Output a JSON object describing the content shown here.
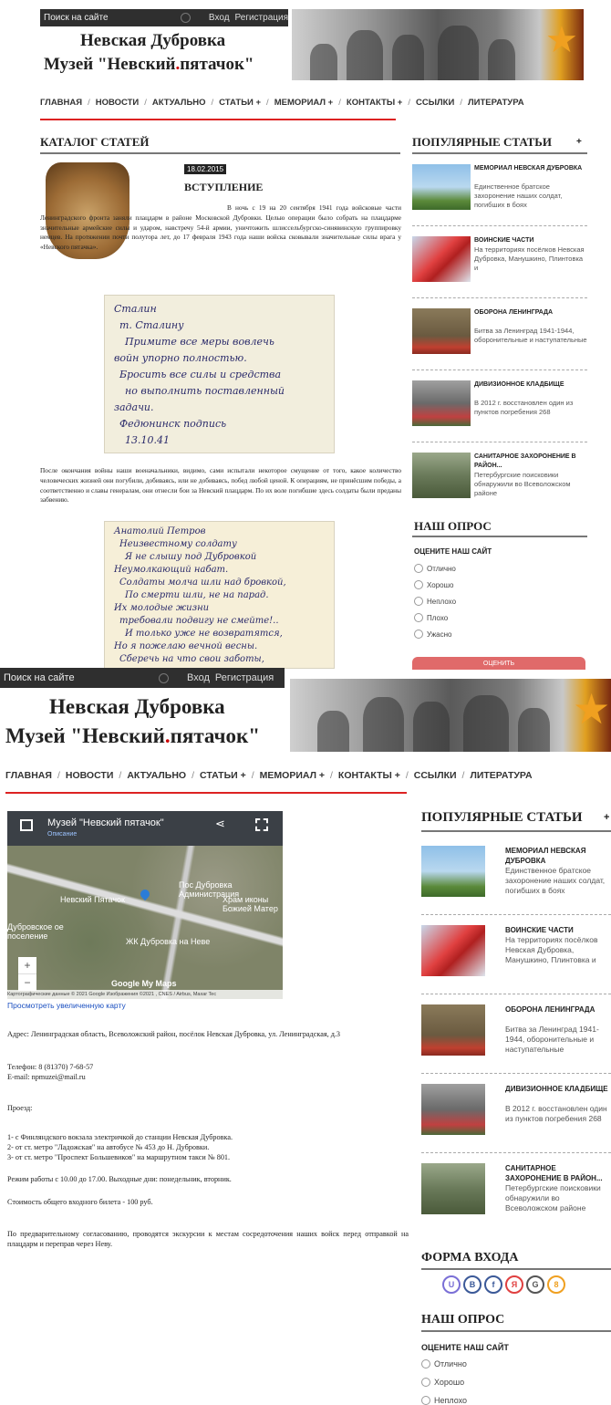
{
  "panel1": {
    "topbar": {
      "search_placeholder": "Поиск на сайте",
      "login": "Вход",
      "register": "Регистрация"
    },
    "site": {
      "title_line1": "Невская Дубровка",
      "title_line2_prefix": "Музей \"Невский",
      "title_dot": ".",
      "title_line2_suffix": "пятачок\""
    },
    "nav": [
      "ГЛАВНАЯ",
      "НОВОСТИ",
      "АКТУАЛЬНО",
      "СТАТЬИ +",
      "МЕМОРИАЛ +",
      "КОНТАКТЫ +",
      "ССЫЛКИ",
      "ЛИТЕРАТУРА"
    ],
    "nav_sep": "/",
    "catalog_heading": "КАТАЛОГ СТАТЕЙ",
    "article": {
      "date": "18.02.2015",
      "title": "ВСТУПЛЕНИЕ",
      "para1": "В ночь с 19 на 20 сентября 1941 года войсковые части Ленинградского фронта заняли плацдарм в районе Московской Дубровки. Целью операции было собрать на плацдарме значительные армейские силы и ударом, навстречу 54-й армии, уничтожить шлиссельбургско-синявинскую группировку немцев. На протяжении почти полутора лет, до 17 февраля 1943 года наши войска сковывали значительные силы врага у «Невского пятачка».",
      "para2": "После окончания войны наши военачальники, видимо, сами испытали некоторое смущение от того, какое количество человеческих жизней они погубили, добиваясь, или не добиваясь, побед любой ценой. К операциям, не принёсшим победы, а соответственно и славы генералам, они отнесли бои за Невский плацдарм. По их воле погибшие здесь солдаты были преданы забвению.",
      "letter1": [
        "Сталин",
        "т. Сталину",
        "Примите все меры вовлечь",
        "войн упорно полностью.",
        "Бросить все силы и средства",
        "но выполнить поставленный",
        "задачи.",
        "Федюнинск      подпись",
        "13.10.41"
      ],
      "letter2": [
        "Анатолий Петров",
        "Неизвестному солдату",
        "Я не слышу под Дубровкой",
        "Неумолкающий набат.",
        "Солдаты молча шли над бровкой,",
        "По смерти шли, не на парад.",
        "Их молодые жизни",
        "требовали подвигу не смейте!..",
        "И только уже не возвратятся,",
        "Но я пожелаю вечной весны.",
        "Сберечь на что свои заботы,"
      ]
    },
    "popular": {
      "heading": "ПОПУЛЯРНЫЕ СТАТЬИ",
      "plus": "+",
      "items": [
        {
          "title": "МЕМОРИАЛ НЕВСКАЯ ДУБРОВКА",
          "desc": "Единственное братское захоронение наших солдат, погибших в боях"
        },
        {
          "title": "ВОИНСКИЕ ЧАСТИ",
          "desc": "На территориях посёлков Невская Дубровка, Манушкино, Плинтовка и"
        },
        {
          "title": "ОБОРОНА ЛЕНИНГРАДА",
          "desc": "Битва за Ленинград 1941-1944, оборонительные и наступательные"
        },
        {
          "title": "ДИВИЗИОННОЕ КЛАДБИЩЕ",
          "desc": "В 2012 г. восстановлен один из пунктов погребения 268"
        },
        {
          "title": "САНИТАРНОЕ ЗАХОРОНЕНИЕ В РАЙОН...",
          "desc": "Петербургские поисковики обнаружили во Всеволожском районе"
        }
      ]
    },
    "poll": {
      "heading": "НАШ ОПРОС",
      "question": "ОЦЕНИТЕ НАШ САЙТ",
      "options": [
        "Отлично",
        "Хорошо",
        "Неплохо",
        "Плохо",
        "Ужасно"
      ],
      "button": "ОЦЕНИТЬ"
    }
  },
  "panel2": {
    "map": {
      "title": "Музей \"Невский пятачок\"",
      "subtitle": "Описание",
      "labels": [
        "Пос Дубровка Администрация",
        "Невский Пятачок",
        "Храм иконы Божией Матер",
        "Дубровское ое поселение",
        "ЖК Дубровка на Неве"
      ],
      "brand": "Google My Maps",
      "attribution": "Картографические данные © 2021 Google Изображения ©2021 , CNES / Airbus, Maxar Tec",
      "link": "Просмотреть увеличенную карту"
    },
    "address": "Адрес: Ленинградская область, Всеволожский район, посёлок Невская Дубровка, ул. Ленинградская, д.3",
    "phone": "Телефон: 8 (81370) 7-68-57",
    "email": "E-mail:  npmuzei@mail.ru",
    "route_heading": "Проезд:",
    "routes": [
      "1- с Финляндского вокзала электричкой до станции Невская Дубровка.",
      "2- от ст. метро \"Ладожская\" на автобусе № 453 до Н. Дубровки.",
      "3- от ст. метро \"Проспект Большевиков\" на маршрутном такси № 801."
    ],
    "hours": "Режим работы с 10.00 до 17.00. Выходные дни: понедельник, вторник.",
    "price": "Стоимость общего входного билета - 100 руб.",
    "excursions": "По предварительному согласованию, проводятся экскурсии к местам сосредоточения наших войск перед отправкой на плацдарм и переправ через Неву.",
    "login_heading": "ФОРМА ВХОДА",
    "social": [
      {
        "letter": "U",
        "color": "#7a6fd6"
      },
      {
        "letter": "B",
        "color": "#3b5998"
      },
      {
        "letter": "f",
        "color": "#3b5998"
      },
      {
        "letter": "Я",
        "color": "#e04040"
      },
      {
        "letter": "G",
        "color": "#555555"
      },
      {
        "letter": "8",
        "color": "#f0a020"
      }
    ],
    "poll_options": [
      "Отлично",
      "Хорошо",
      "Неплохо"
    ]
  }
}
